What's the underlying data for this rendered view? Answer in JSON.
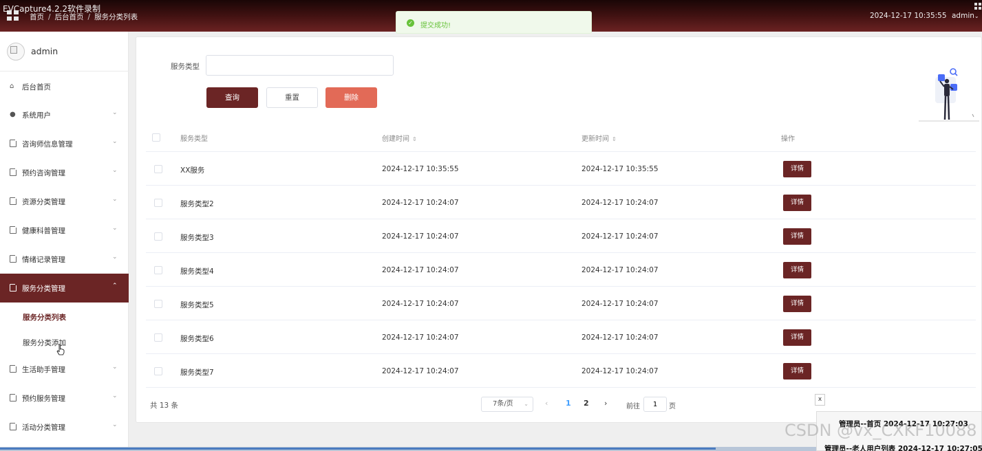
{
  "watermark_top": "EVCapture4.2.2软件录制",
  "header": {
    "breadcrumbs": [
      "首页",
      "后台首页",
      "服务分类列表"
    ],
    "datetime": "2024-12-17 10:35:55",
    "user": "admin"
  },
  "toast": {
    "message": "提交成功!",
    "type": "success"
  },
  "sidebar": {
    "user": "admin",
    "items": [
      {
        "label": "后台首页",
        "icon": "home-icon"
      },
      {
        "label": "系统用户",
        "icon": "user-icon"
      },
      {
        "label": "咨询师信息管理",
        "icon": "doc-icon"
      },
      {
        "label": "预约咨询管理",
        "icon": "doc-icon"
      },
      {
        "label": "资源分类管理",
        "icon": "doc-icon"
      },
      {
        "label": "健康科普管理",
        "icon": "doc-icon"
      },
      {
        "label": "情绪记录管理",
        "icon": "doc-icon"
      },
      {
        "label": "服务分类管理",
        "icon": "doc-icon",
        "active": true
      },
      {
        "label": "生活助手管理",
        "icon": "doc-icon"
      },
      {
        "label": "预约服务管理",
        "icon": "doc-icon"
      },
      {
        "label": "活动分类管理",
        "icon": "doc-icon"
      }
    ],
    "subitems": [
      {
        "label": "服务分类列表",
        "current": true
      },
      {
        "label": "服务分类添加"
      }
    ]
  },
  "search": {
    "label": "服务类型",
    "value": "",
    "buttons": {
      "query": "查询",
      "reset": "重置",
      "delete": "删除"
    }
  },
  "table": {
    "columns": [
      "服务类型",
      "创建时间",
      "更新时间",
      "操作"
    ],
    "rows": [
      {
        "type": "XX服务",
        "created": "2024-12-17 10:35:55",
        "updated": "2024-12-17 10:35:55",
        "action": "详情"
      },
      {
        "type": "服务类型2",
        "created": "2024-12-17 10:24:07",
        "updated": "2024-12-17 10:24:07",
        "action": "详情"
      },
      {
        "type": "服务类型3",
        "created": "2024-12-17 10:24:07",
        "updated": "2024-12-17 10:24:07",
        "action": "详情"
      },
      {
        "type": "服务类型4",
        "created": "2024-12-17 10:24:07",
        "updated": "2024-12-17 10:24:07",
        "action": "详情"
      },
      {
        "type": "服务类型5",
        "created": "2024-12-17 10:24:07",
        "updated": "2024-12-17 10:24:07",
        "action": "详情"
      },
      {
        "type": "服务类型6",
        "created": "2024-12-17 10:24:07",
        "updated": "2024-12-17 10:24:07",
        "action": "详情"
      },
      {
        "type": "服务类型7",
        "created": "2024-12-17 10:24:07",
        "updated": "2024-12-17 10:24:07",
        "action": "详情"
      }
    ]
  },
  "pagination": {
    "total": "共 13 条",
    "page_size": "7条/页",
    "pages": [
      "1",
      "2"
    ],
    "current": "1",
    "goto_prefix": "前往",
    "goto_value": "1",
    "goto_suffix": "页"
  },
  "notifications": {
    "close": "x",
    "line1": "管理员--首页 2024-12-17 10:27:03",
    "line2": "管理员--老人用户列表 2024-12-17 10:27:05"
  },
  "csdn_watermark": "CSDN @vx_CXKF10088",
  "colors": {
    "primary": "#6b2525",
    "danger": "#e26a57",
    "success": "#67c23a",
    "page_active": "#409eff"
  }
}
